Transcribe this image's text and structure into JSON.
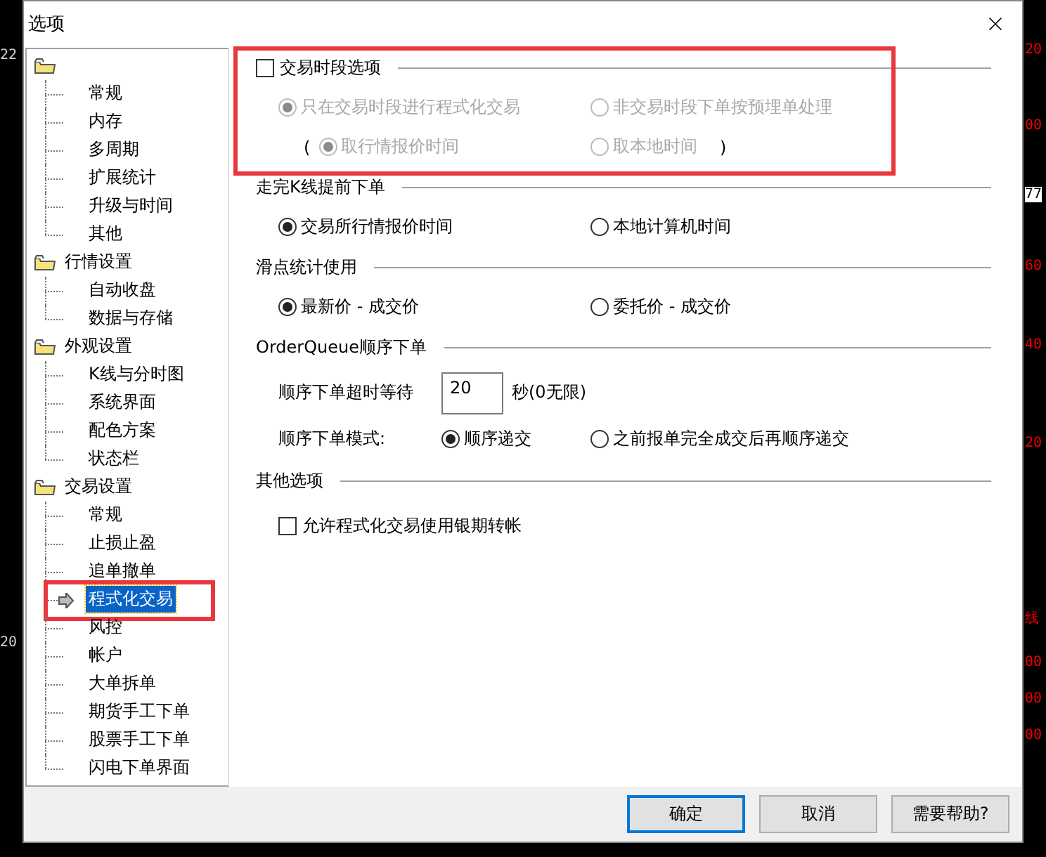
{
  "backdrop": {
    "left_texts": [
      "22",
      "20"
    ],
    "right_texts": [
      "20",
      "00",
      "77",
      "60",
      "40",
      "20",
      "线",
      "00",
      "00",
      "00"
    ]
  },
  "dialog": {
    "title": "选项"
  },
  "tree": [
    {
      "children": [
        {
          "label": "常规",
          "selected": false,
          "highlighted": false
        },
        {
          "label": "内存",
          "selected": false,
          "highlighted": false
        },
        {
          "label": "多周期",
          "selected": false,
          "highlighted": false
        },
        {
          "label": "扩展统计",
          "selected": false,
          "highlighted": false
        },
        {
          "label": "升级与时间",
          "selected": false,
          "highlighted": false
        },
        {
          "label": "其他",
          "selected": false,
          "highlighted": false
        }
      ]
    },
    {
      "label": "行情设置",
      "children": [
        {
          "label": "自动收盘",
          "selected": false,
          "highlighted": false
        },
        {
          "label": "数据与存储",
          "selected": false,
          "highlighted": false
        }
      ]
    },
    {
      "label": "外观设置",
      "children": [
        {
          "label": "K线与分时图",
          "selected": false,
          "highlighted": false
        },
        {
          "label": "系统界面",
          "selected": false,
          "highlighted": false
        },
        {
          "label": "配色方案",
          "selected": false,
          "highlighted": false
        },
        {
          "label": "状态栏",
          "selected": false,
          "highlighted": false
        }
      ]
    },
    {
      "label": "交易设置",
      "children": [
        {
          "label": "常规",
          "selected": false,
          "highlighted": false
        },
        {
          "label": "止损止盈",
          "selected": false,
          "highlighted": false
        },
        {
          "label": "追单撤单",
          "selected": false,
          "highlighted": false
        },
        {
          "label": "程式化交易",
          "selected": true,
          "highlighted": true
        },
        {
          "label": "风控",
          "selected": false,
          "highlighted": false
        },
        {
          "label": "帐户",
          "selected": false,
          "highlighted": false
        },
        {
          "label": "大单拆单",
          "selected": false,
          "highlighted": false
        },
        {
          "label": "期货手工下单",
          "selected": false,
          "highlighted": false
        },
        {
          "label": "股票手工下单",
          "selected": false,
          "highlighted": false
        },
        {
          "label": "闪电下单界面",
          "selected": false,
          "highlighted": false
        }
      ]
    }
  ],
  "sections": [
    {
      "kind": "check",
      "title": "交易时段选项",
      "checked": false,
      "highlighted": true,
      "rows": [
        {
          "kind": "radios",
          "options": [
            {
              "label": "只在交易时段进行程式化交易",
              "selected": true,
              "disabled": true
            },
            {
              "label": "非交易时段下单按预埋单处理",
              "selected": false,
              "disabled": true
            }
          ]
        },
        {
          "kind": "radios",
          "open": "(",
          "close": ")",
          "options": [
            {
              "label": "取行情报价时间",
              "selected": true,
              "disabled": true
            },
            {
              "label": "取本地时间",
              "selected": false,
              "disabled": true
            }
          ]
        }
      ]
    },
    {
      "kind": "plain",
      "title": "走完K线提前下单",
      "highlighted": false,
      "rows": [
        {
          "kind": "radios",
          "options": [
            {
              "label": "交易所行情报价时间",
              "selected": true,
              "disabled": false
            },
            {
              "label": "本地计算机时间",
              "selected": false,
              "disabled": false
            }
          ]
        }
      ]
    },
    {
      "kind": "plain",
      "title": "滑点统计使用",
      "highlighted": false,
      "rows": [
        {
          "kind": "radios",
          "options": [
            {
              "label": "最新价 - 成交价",
              "selected": true,
              "disabled": false
            },
            {
              "label": "委托价 - 成交价",
              "selected": false,
              "disabled": false
            }
          ]
        }
      ]
    },
    {
      "kind": "plain",
      "title": "OrderQueue顺序下单",
      "highlighted": false,
      "rows": [
        {
          "kind": "field",
          "label": "顺序下单超时等待",
          "value": "20",
          "suffix": "秒(0无限)"
        },
        {
          "kind": "labeled_radios",
          "label": "顺序下单模式:",
          "options": [
            {
              "label": "顺序递交",
              "selected": true,
              "disabled": false
            },
            {
              "label": "之前报单完全成交后再顺序递交",
              "selected": false,
              "disabled": false
            }
          ]
        }
      ]
    },
    {
      "kind": "plain",
      "title": "其他选项",
      "highlighted": false,
      "rows": [
        {
          "kind": "checkbox",
          "label": "允许程式化交易使用银期转帐",
          "checked": false
        }
      ]
    }
  ],
  "buttons": [
    {
      "label": "确定",
      "default": true
    },
    {
      "label": "取消",
      "default": false
    },
    {
      "label": "需要帮助?",
      "default": false
    }
  ]
}
